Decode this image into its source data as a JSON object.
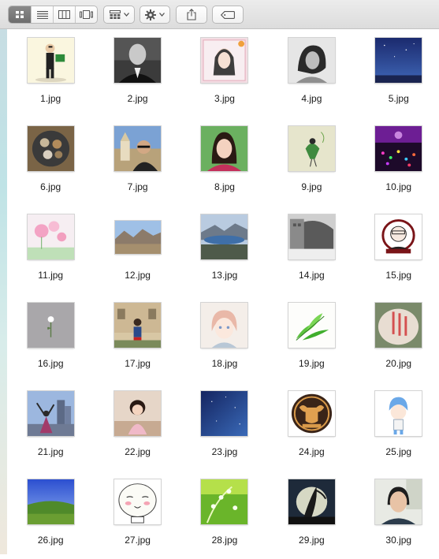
{
  "toolbar": {
    "view_modes": [
      "icon-view",
      "list-view",
      "column-view",
      "cover-flow-view"
    ],
    "active_view": "icon-view",
    "arrange_icon": "grid-arrange-icon",
    "action_icon": "gear-icon",
    "share_icon": "share-icon",
    "tags_icon": "tag-icon"
  },
  "colors": {
    "toolbar_bg": "#e4e4e4",
    "active_segment": "#7a7a7a",
    "filename_text": "#1a1a1a"
  },
  "files": [
    {
      "name": "1.jpg",
      "shape": "portrait"
    },
    {
      "name": "2.jpg",
      "shape": "landscape"
    },
    {
      "name": "3.jpg",
      "shape": "portrait"
    },
    {
      "name": "4.jpg",
      "shape": "portrait"
    },
    {
      "name": "5.jpg",
      "shape": "portrait"
    },
    {
      "name": "6.jpg",
      "shape": "portrait"
    },
    {
      "name": "7.jpg",
      "shape": "landscape"
    },
    {
      "name": "8.jpg",
      "shape": "portrait"
    },
    {
      "name": "9.jpg",
      "shape": "portrait"
    },
    {
      "name": "10.jpg",
      "shape": "portrait"
    },
    {
      "name": "11.jpg",
      "shape": "portrait"
    },
    {
      "name": "12.jpg",
      "shape": "wide"
    },
    {
      "name": "13.jpg",
      "shape": "portrait"
    },
    {
      "name": "14.jpg",
      "shape": "portrait"
    },
    {
      "name": "15.jpg",
      "shape": "portrait"
    },
    {
      "name": "16.jpg",
      "shape": "portrait"
    },
    {
      "name": "17.jpg",
      "shape": "landscape"
    },
    {
      "name": "18.jpg",
      "shape": "portrait"
    },
    {
      "name": "19.jpg",
      "shape": "portrait"
    },
    {
      "name": "20.jpg",
      "shape": "portrait"
    },
    {
      "name": "21.jpg",
      "shape": "portrait"
    },
    {
      "name": "22.jpg",
      "shape": "landscape"
    },
    {
      "name": "23.jpg",
      "shape": "portrait"
    },
    {
      "name": "24.jpg",
      "shape": "portrait"
    },
    {
      "name": "25.jpg",
      "shape": "portrait"
    },
    {
      "name": "26.jpg",
      "shape": "portrait"
    },
    {
      "name": "27.jpg",
      "shape": "landscape"
    },
    {
      "name": "28.jpg",
      "shape": "portrait"
    },
    {
      "name": "29.jpg",
      "shape": "portrait"
    },
    {
      "name": "30.jpg",
      "shape": "portrait"
    }
  ]
}
